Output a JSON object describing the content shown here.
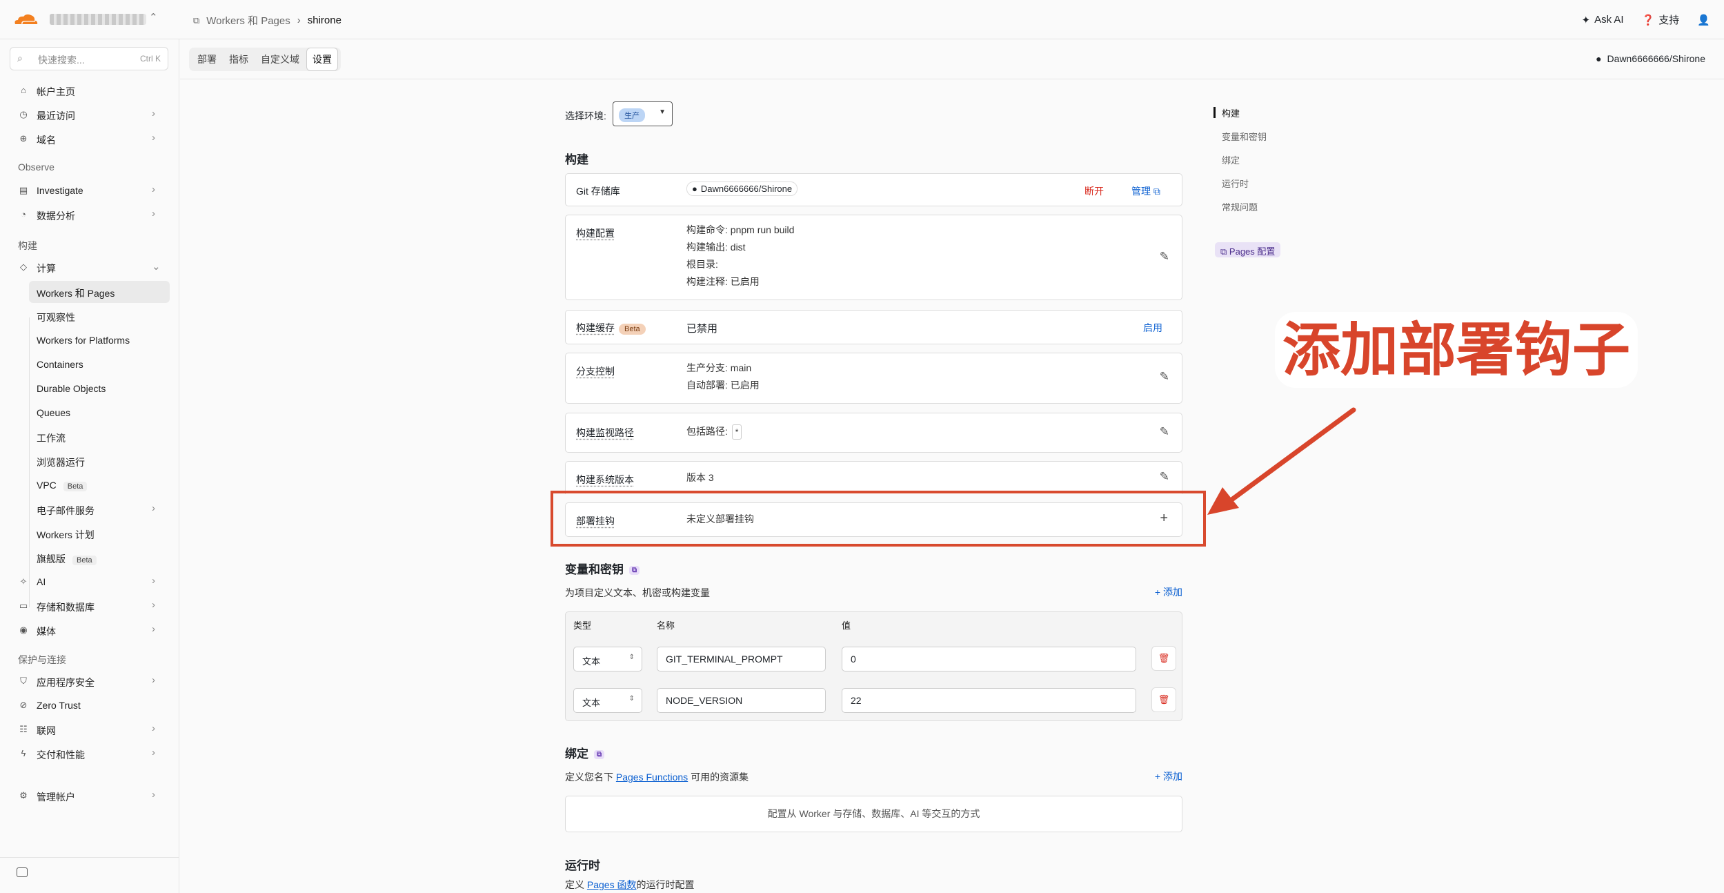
{
  "topbar": {
    "breadcrumb_root": "Workers 和 Pages",
    "breadcrumb_current": "shirone",
    "ask_ai": "Ask AI",
    "support": "支持"
  },
  "sidebar": {
    "search_placeholder": "快速搜索...",
    "search_shortcut": "Ctrl K",
    "items": [
      {
        "label": "帐户主页",
        "icon": "home-icon"
      },
      {
        "label": "最近访问",
        "icon": "clock-icon"
      },
      {
        "label": "域名",
        "icon": "globe-icon"
      }
    ],
    "group_observe": "Observe",
    "observe_items": [
      {
        "label": "Investigate"
      },
      {
        "label": "数据分析"
      }
    ],
    "group_build": "构建",
    "compute_label": "计算",
    "compute_children": [
      {
        "label": "Workers 和 Pages"
      },
      {
        "label": "可观察性"
      },
      {
        "label": "Workers for Platforms"
      },
      {
        "label": "Containers"
      },
      {
        "label": "Durable Objects"
      },
      {
        "label": "Queues"
      },
      {
        "label": "工作流"
      },
      {
        "label": "浏览器运行"
      },
      {
        "label": "VPC",
        "badge": "Beta"
      },
      {
        "label": "电子邮件服务"
      },
      {
        "label": "Workers 计划"
      },
      {
        "label": "旗舰版",
        "badge": "Beta"
      }
    ],
    "more_items": [
      {
        "label": "AI"
      },
      {
        "label": "存储和数据库"
      },
      {
        "label": "媒体"
      }
    ],
    "group_protect": "保护与连接",
    "protect_items": [
      {
        "label": "应用程序安全"
      },
      {
        "label": "Zero Trust"
      },
      {
        "label": "联网"
      },
      {
        "label": "交付和性能"
      }
    ],
    "manage_account": "管理帐户"
  },
  "tabs": [
    {
      "label": "部署"
    },
    {
      "label": "指标"
    },
    {
      "label": "自定义域"
    },
    {
      "label": "设置",
      "active": true
    }
  ],
  "repo_link": "Dawn6666666/Shirone",
  "main": {
    "env_label": "选择环境:",
    "env_value": "生产",
    "section_build": "构建",
    "git": {
      "label": "Git 存储库",
      "repo": "Dawn6666666/Shirone",
      "disconnect": "断开",
      "manage": "管理"
    },
    "build_config": {
      "label": "构建配置",
      "lines": [
        "构建命令: pnpm run build",
        "构建输出: dist",
        "根目录:",
        "构建注释: 已启用"
      ]
    },
    "build_cache": {
      "label": "构建缓存",
      "badge": "Beta",
      "value": "已禁用",
      "action": "启用"
    },
    "branch": {
      "label": "分支控制",
      "lines": [
        "生产分支: main",
        "自动部署: 已启用"
      ]
    },
    "watch_paths": {
      "label": "构建监视路径",
      "prefix": "包括路径:",
      "value": "*"
    },
    "system_version": {
      "label": "构建系统版本",
      "value": "版本 3"
    },
    "deploy_hooks": {
      "label": "部署挂钩",
      "value": "未定义部署挂钩"
    },
    "section_vars": "变量和密钥",
    "vars_desc": "为项目定义文本、机密或构建变量",
    "add": "添加",
    "var_headers": {
      "type": "类型",
      "name": "名称",
      "value": "值"
    },
    "vars": [
      {
        "type": "文本",
        "name": "GIT_TERMINAL_PROMPT",
        "value": "0"
      },
      {
        "type": "文本",
        "name": "NODE_VERSION",
        "value": "22"
      }
    ],
    "section_bindings": "绑定",
    "bindings_desc_prefix": "定义您名下",
    "bindings_desc_link": "Pages Functions",
    "bindings_desc_suffix": "可用的资源集",
    "bindings_empty": "配置从 Worker 与存储、数据库、AI 等交互的方式",
    "section_runtime": "运行时",
    "runtime_desc_prefix": "定义",
    "runtime_desc_link": "Pages 函数",
    "runtime_desc_suffix": "的运行时配置"
  },
  "toc": [
    {
      "label": "构建",
      "active": true
    },
    {
      "label": "变量和密钥"
    },
    {
      "label": "绑定"
    },
    {
      "label": "运行时"
    },
    {
      "label": "常规问题"
    }
  ],
  "pages_config": "Pages 配置",
  "annotation": "添加部署钩子",
  "colors": {
    "accent": "#0a5fd1",
    "danger": "#d92c20",
    "annotation": "#d8452b",
    "brand": "#f38020"
  }
}
